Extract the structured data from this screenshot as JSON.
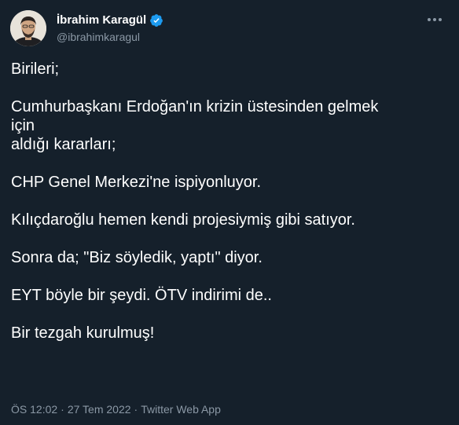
{
  "author": {
    "display_name": "İbrahim Karagül",
    "handle": "@ibrahimkaragul",
    "verified": true,
    "avatar_icon": "profile-photo",
    "colors": {
      "verified_badge": "#1d9bf0",
      "background": "#15202b",
      "muted": "#8b98a5"
    }
  },
  "menu": {
    "icon": "more-options-icon"
  },
  "tweet": {
    "text": "Birileri;\n\nCumhurbaşkanı Erdoğan'ın krizin üstesinden gelmek\niçin\naldığı kararları;\n\nCHP Genel Merkezi'ne ispiyonluyor.\n\nKılıçdaroğlu hemen kendi projesiymiş gibi satıyor.\n\nSonra da; \"Biz söyledik, yaptı\" diyor.\n\nEYT böyle bir şeydi. ÖTV indirimi de..\n\nBir tezgah kurulmuş!"
  },
  "meta": {
    "time": "ÖS 12:02",
    "separator": "·",
    "date": "27 Tem 2022",
    "source": "Twitter Web App"
  }
}
